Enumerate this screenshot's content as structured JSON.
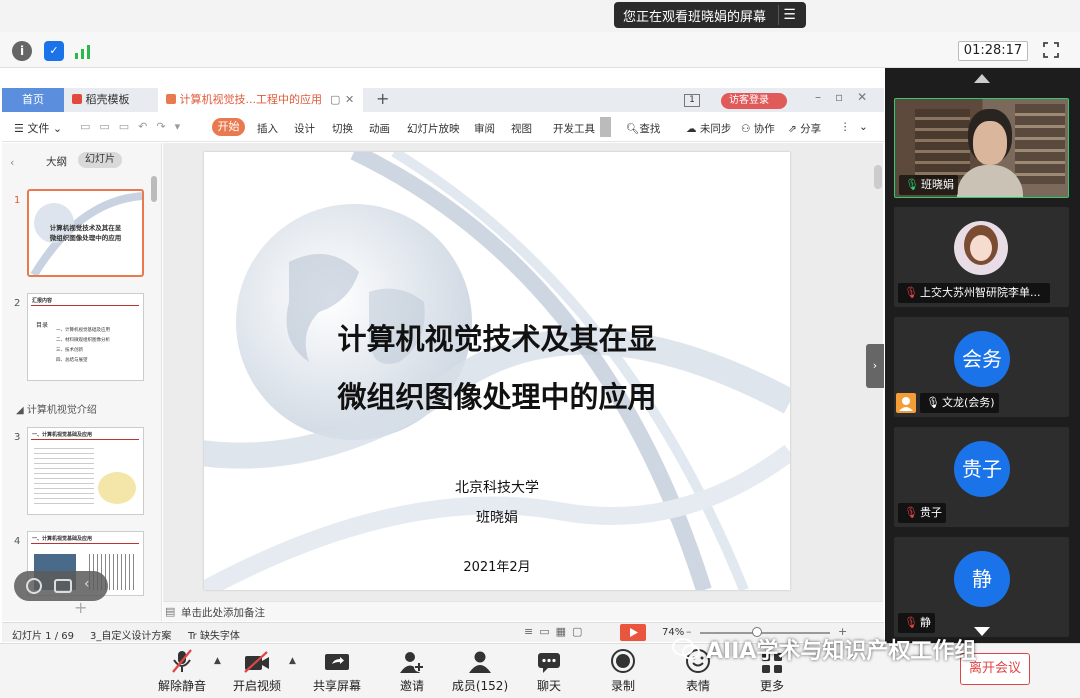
{
  "share_banner": {
    "text": "您正在观看班晓娟的屏幕",
    "menu_icon": "menu-icon"
  },
  "top_bar": {
    "timer": "01:28:17"
  },
  "wps": {
    "tabs": [
      "首页",
      "稻壳模板",
      "计算机视觉技...工程中的应用"
    ],
    "tab_badge": "1",
    "visitor_login": "访客登录",
    "file_menu": "文件",
    "start": "开始",
    "ribbon": [
      "插入",
      "设计",
      "切换",
      "动画",
      "幻灯片放映",
      "审阅",
      "视图",
      "开发工具"
    ],
    "search": "查找",
    "right_actions": [
      "未同步",
      "协作",
      "分享"
    ],
    "panel_tabs": [
      "大纲",
      "幻灯片"
    ],
    "section_label": "计算机视觉介绍",
    "thumb_numbers": [
      "1",
      "2",
      "3",
      "4"
    ],
    "thumb1_lines": [
      "计算机视觉技术及其在显",
      "微组织图像处理中的应用"
    ],
    "thumb2_title": "汇报内容",
    "thumb2_catalog": "目录",
    "thumb2_items": [
      "一、计算机视觉基础及应用",
      "二、材料微观组织图像分析",
      "三、技术创新",
      "四、总结与展望"
    ],
    "thumb3_title": "一、计算机视觉基础及应用",
    "thumb4_title": "一、计算机视觉基础及应用",
    "notes": "单击此处添加备注",
    "status": {
      "slide": "幻灯片 1 / 69",
      "theme": "3_自定义设计方案",
      "font": "缺失字体",
      "zoom": "74%"
    }
  },
  "slide": {
    "title_line1": "计算机视觉技术及其在显",
    "title_line2": "微组织图像处理中的应用",
    "org": "北京科技大学",
    "author": "班晓娟",
    "date": "2021年2月"
  },
  "video": {
    "tiles": [
      {
        "name": "班晓娟",
        "avatar": ""
      },
      {
        "name": "上交大苏州智研院李单...",
        "avatar": ""
      },
      {
        "name": "文龙(会务)",
        "avatar": "会务"
      },
      {
        "name": "贵子",
        "avatar": "贵子"
      },
      {
        "name": "静",
        "avatar": "静"
      }
    ]
  },
  "toolbar": {
    "buttons": [
      "解除静音",
      "开启视频",
      "共享屏幕",
      "邀请",
      "成员(152)",
      "聊天",
      "录制",
      "表情",
      "更多"
    ],
    "leave": "离开会议"
  },
  "watermark": "AIIA学术与知识产权工作组",
  "colors": {
    "accent": "#e97a4f",
    "avatar_blue": "#1a73e8",
    "leave_red": "#e04545"
  }
}
